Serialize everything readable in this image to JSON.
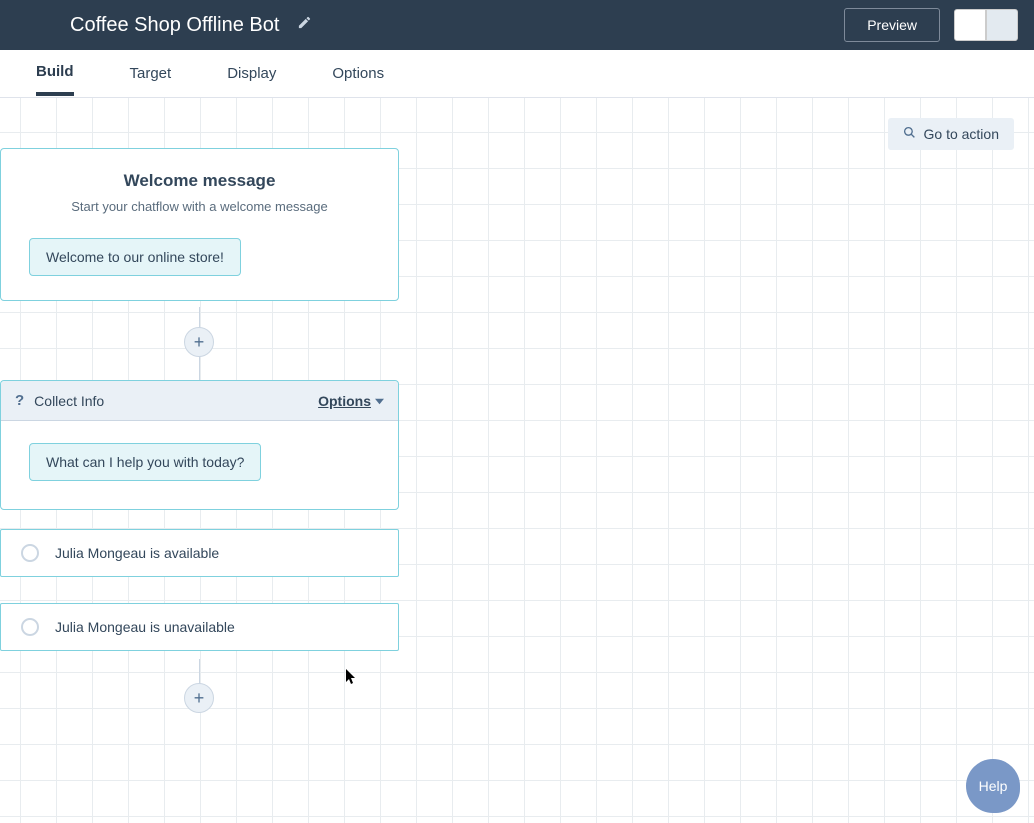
{
  "header": {
    "title": "Coffee Shop Offline Bot",
    "preview_label": "Preview"
  },
  "tabs": {
    "items": [
      {
        "label": "Build",
        "active": true
      },
      {
        "label": "Target",
        "active": false
      },
      {
        "label": "Display",
        "active": false
      },
      {
        "label": "Options",
        "active": false
      }
    ]
  },
  "canvas": {
    "goto_action_label": "Go to action",
    "welcome": {
      "title": "Welcome message",
      "subtitle": "Start your chatflow with a welcome message",
      "bubble": "Welcome to our online store!"
    },
    "collect": {
      "name": "Collect Info",
      "options_label": "Options",
      "bubble": "What can I help you with today?"
    },
    "branches": [
      {
        "label": "Julia Mongeau is available"
      },
      {
        "label": "Julia Mongeau is unavailable"
      }
    ]
  },
  "help_label": "Help"
}
